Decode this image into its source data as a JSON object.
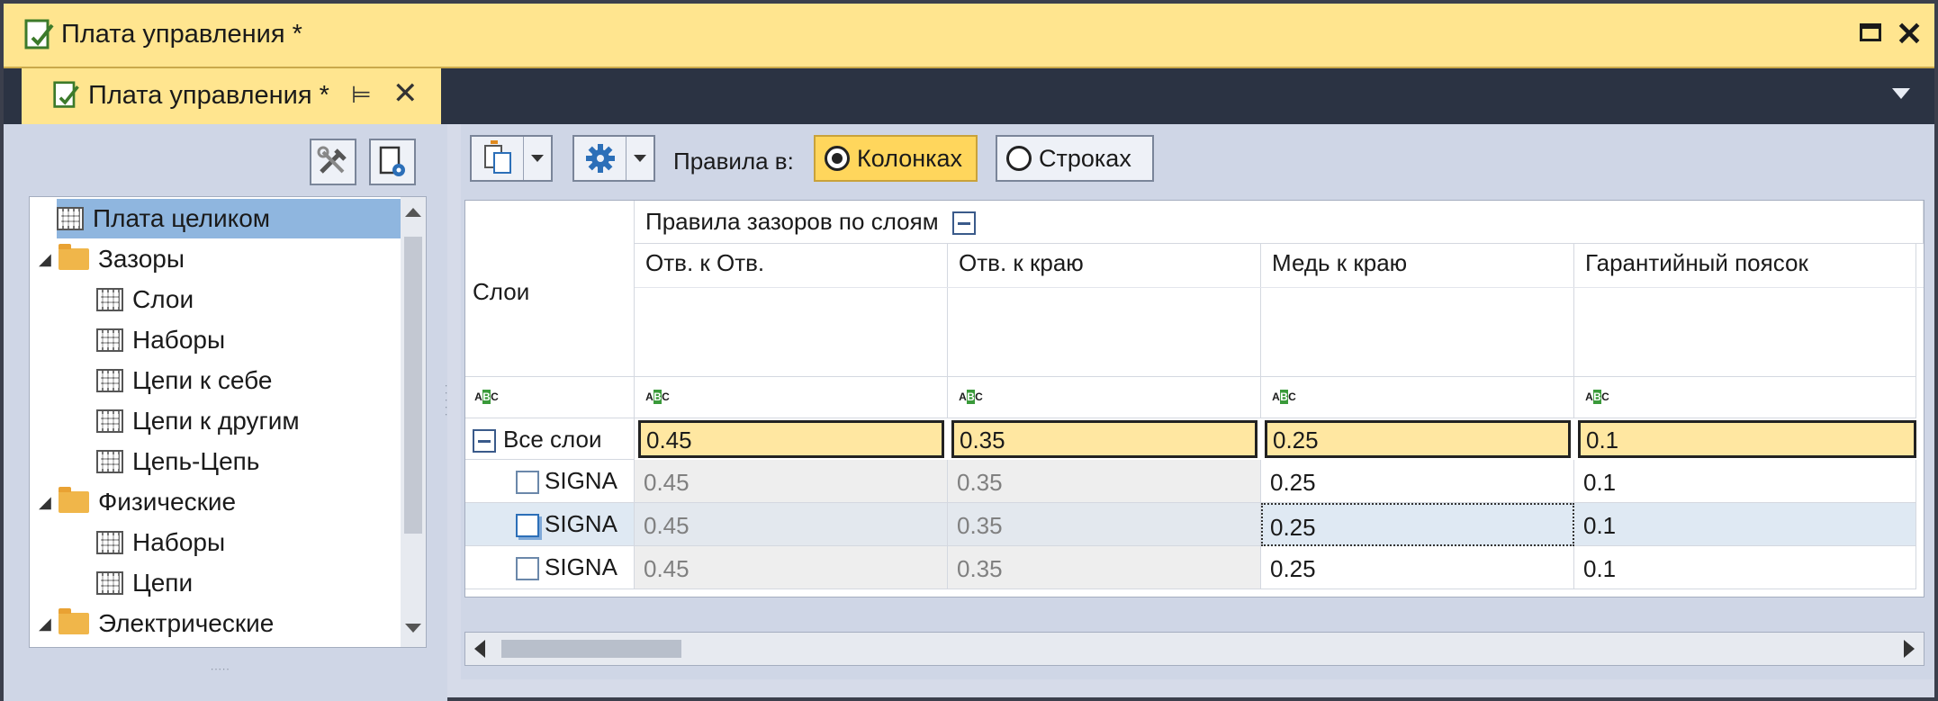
{
  "window": {
    "title": "Плата управления *"
  },
  "tab": {
    "title": "Плата управления *",
    "pin": "⊨",
    "close": "✕"
  },
  "title_controls": {
    "close": "✕"
  },
  "left": {
    "tree": [
      {
        "label": "Плата целиком",
        "icon": "grid-icon",
        "level": 0,
        "selected": true
      },
      {
        "label": "Зазоры",
        "icon": "folder-icon",
        "level": 0,
        "expander": "◢"
      },
      {
        "label": "Слои",
        "icon": "grid-icon",
        "level": 1
      },
      {
        "label": "Наборы",
        "icon": "grid-icon",
        "level": 1
      },
      {
        "label": "Цепи к себе",
        "icon": "grid-icon",
        "level": 1
      },
      {
        "label": "Цепи к другим",
        "icon": "grid-icon",
        "level": 1
      },
      {
        "label": "Цепь-Цепь",
        "icon": "grid-icon",
        "level": 1
      },
      {
        "label": "Физические",
        "icon": "folder-icon",
        "level": 0,
        "expander": "◢"
      },
      {
        "label": "Наборы",
        "icon": "grid-icon",
        "level": 1
      },
      {
        "label": "Цепи",
        "icon": "grid-icon",
        "level": 1
      },
      {
        "label": "Электрические",
        "icon": "folder-icon",
        "level": 0,
        "expander": "◢"
      }
    ]
  },
  "toolbar": {
    "rules_label": "Правила в:",
    "columns_option": "Колонках",
    "rows_option": "Строках",
    "selected": "Колонках"
  },
  "grid": {
    "group_header": "Правила зазоров по слоям",
    "layers_header": "Слои",
    "columns": [
      "Отв. к Отв.",
      "Отв. к краю",
      "Медь к краю",
      "Гарантийный поясок"
    ],
    "rows": [
      {
        "name": "Все слои",
        "values": [
          "0.45",
          "0.35",
          "0.25",
          "0.1"
        ],
        "kind": "all"
      },
      {
        "name": "SIGNA",
        "values": [
          "0.45",
          "0.35",
          "0.25",
          "0.1"
        ],
        "kind": "layer"
      },
      {
        "name": "SIGNA",
        "values": [
          "0.45",
          "0.35",
          "0.25",
          "0.1"
        ],
        "kind": "layer-active"
      },
      {
        "name": "SIGNA",
        "values": [
          "0.45",
          "0.35",
          "0.25",
          "0.1"
        ],
        "kind": "layer"
      }
    ]
  },
  "colors": {
    "accent": "#ffe58f",
    "selected_row": "#8fb6df",
    "dark_strip": "#2b3343"
  }
}
